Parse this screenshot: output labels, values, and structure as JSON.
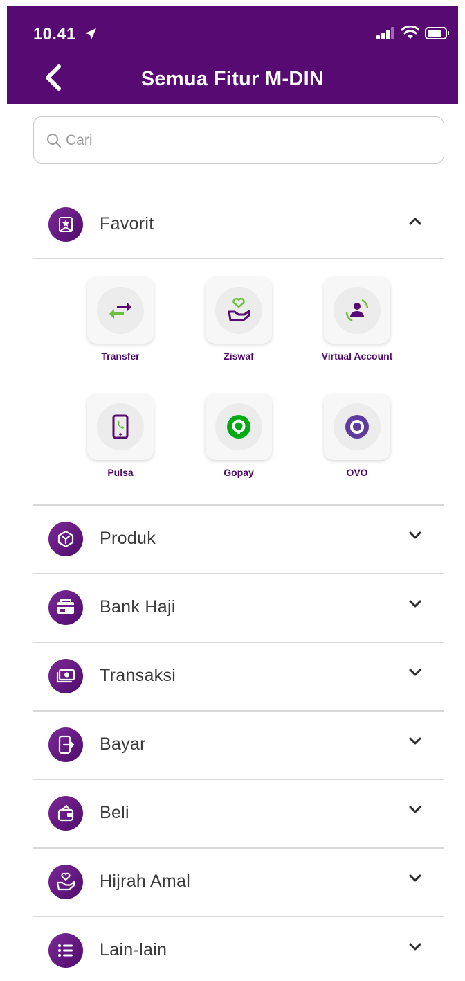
{
  "status_bar": {
    "time": "10.41"
  },
  "nav": {
    "title": "Semua Fitur M-DIN"
  },
  "search": {
    "placeholder": "Cari",
    "value": ""
  },
  "favorit": {
    "label": "Favorit",
    "items": [
      {
        "label": "Transfer",
        "icon": "transfer-icon"
      },
      {
        "label": "Ziswaf",
        "icon": "ziswaf-icon"
      },
      {
        "label": "Virtual Account",
        "icon": "virtual-account-icon"
      },
      {
        "label": "Pulsa",
        "icon": "pulsa-icon"
      },
      {
        "label": "Gopay",
        "icon": "gopay-icon"
      },
      {
        "label": "OVO",
        "icon": "ovo-icon"
      }
    ]
  },
  "sections": [
    {
      "label": "Produk",
      "icon": "produk-icon"
    },
    {
      "label": "Bank Haji",
      "icon": "bank-haji-icon"
    },
    {
      "label": "Transaksi",
      "icon": "transaksi-icon"
    },
    {
      "label": "Bayar",
      "icon": "bayar-icon"
    },
    {
      "label": "Beli",
      "icon": "beli-icon"
    },
    {
      "label": "Hijrah Amal",
      "icon": "hijrah-amal-icon"
    },
    {
      "label": "Lain-lain",
      "icon": "lain-lain-icon"
    }
  ],
  "colors": {
    "brand": "#570a72",
    "accent_green": "#6bbf3a",
    "gopay_green": "#00aa13",
    "ovo_purple": "#5e3b9f"
  }
}
